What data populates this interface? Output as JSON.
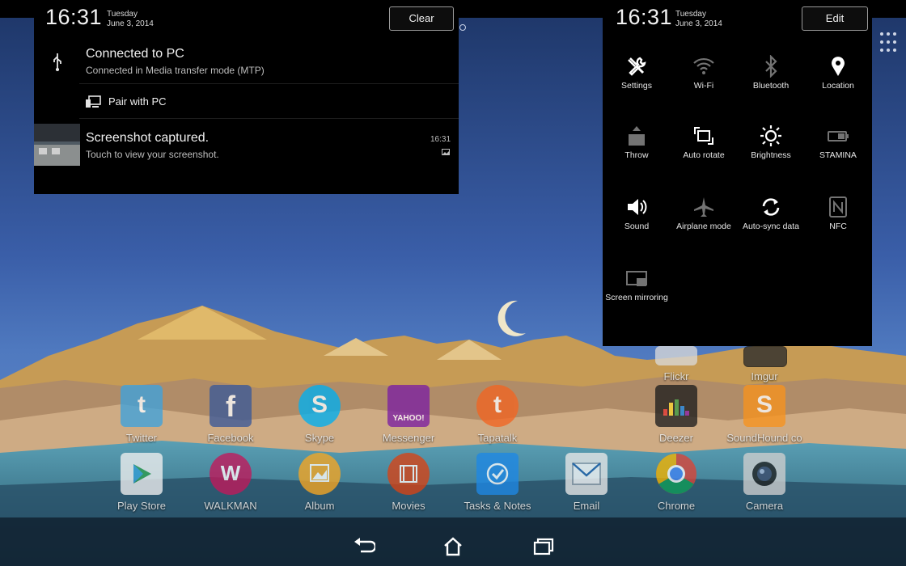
{
  "notification_panel": {
    "time": "16:31",
    "day": "Tuesday",
    "date": "June 3, 2014",
    "clear_label": "Clear",
    "items": [
      {
        "title": "Connected to PC",
        "subtitle": "Connected in Media transfer mode (MTP)"
      },
      {
        "title": "Pair with PC"
      },
      {
        "title": "Screenshot captured.",
        "subtitle": "Touch to view your screenshot.",
        "time": "16:31"
      }
    ]
  },
  "quick_settings": {
    "time": "16:31",
    "day": "Tuesday",
    "date": "June 3, 2014",
    "edit_label": "Edit",
    "tiles": [
      {
        "label": "Settings",
        "icon": "tools-icon",
        "enabled": true
      },
      {
        "label": "Wi-Fi",
        "icon": "wifi-icon",
        "enabled": false
      },
      {
        "label": "Bluetooth",
        "icon": "bluetooth-icon",
        "enabled": false
      },
      {
        "label": "Location",
        "icon": "location-pin-icon",
        "enabled": true
      },
      {
        "label": "Throw",
        "icon": "throw-icon",
        "enabled": false
      },
      {
        "label": "Auto rotate",
        "icon": "rotate-icon",
        "enabled": true
      },
      {
        "label": "Brightness",
        "icon": "brightness-icon",
        "enabled": true
      },
      {
        "label": "STAMINA",
        "icon": "battery-icon",
        "enabled": false
      },
      {
        "label": "Sound",
        "icon": "speaker-icon",
        "enabled": true
      },
      {
        "label": "Airplane mode",
        "icon": "airplane-icon",
        "enabled": false
      },
      {
        "label": "Auto-sync data",
        "icon": "sync-icon",
        "enabled": true
      },
      {
        "label": "NFC",
        "icon": "nfc-icon",
        "enabled": false
      },
      {
        "label": "Screen mirroring",
        "icon": "screen-mirroring-icon",
        "enabled": false
      }
    ]
  },
  "home_apps": [
    {
      "label": "Flickr",
      "color": "#d9d9d9"
    },
    {
      "label": "Imgur",
      "color": "#2b2b2b"
    },
    {
      "label": "Twitter",
      "color": "#3fa3dd"
    },
    {
      "label": "Facebook",
      "color": "#3b5998"
    },
    {
      "label": "Skype",
      "color": "#00aff0"
    },
    {
      "label": "Messenger",
      "color": "#7b1fa2"
    },
    {
      "label": "Tapatalk",
      "color": "#f26522"
    },
    {
      "label": "Deezer",
      "color": "#1f1f1f"
    },
    {
      "label": "SoundHound co",
      "color": "#f7931e"
    },
    {
      "label": "Play Store",
      "color": "#f0f0f0"
    },
    {
      "label": "WALKMAN",
      "color": "#c2185b"
    },
    {
      "label": "Album",
      "color": "#f6a723"
    },
    {
      "label": "Movies",
      "color": "#d84315"
    },
    {
      "label": "Tasks & Notes",
      "color": "#1e88e5"
    },
    {
      "label": "Email",
      "color": "#e8e8e8"
    },
    {
      "label": "Chrome",
      "color": "#4caf50"
    },
    {
      "label": "Camera",
      "color": "#cfcfcf"
    }
  ],
  "app_glyphs": {
    "twitter": "t",
    "facebook": "f",
    "skype": "S",
    "messenger": "YAHOO!",
    "tapatalk": "t",
    "soundhound": "S"
  },
  "navigation": {
    "back": "back-icon",
    "home": "home-icon",
    "recent": "recent-apps-icon"
  }
}
